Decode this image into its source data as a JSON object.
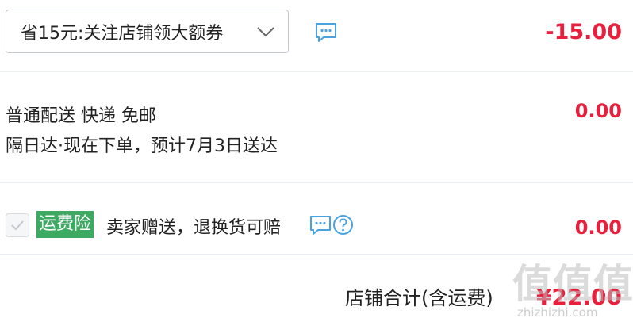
{
  "coupon": {
    "selected": "省15元:关注店铺领大额券",
    "amount": "-15.00",
    "icons": [
      "chevron-down-icon",
      "message-icon"
    ]
  },
  "shipping": {
    "method": "普通配送 快递 免邮",
    "delivery_note": "隔日达·现在下单，预计7月3日送达",
    "amount": "0.00"
  },
  "insurance": {
    "badge": "运费险",
    "description": "卖家赠送，退换货可赔",
    "amount": "0.00",
    "icons": [
      "checkbox-icon",
      "message-icon",
      "question-icon"
    ]
  },
  "total": {
    "label": "店铺合计(含运费)",
    "amount": "¥22.00"
  },
  "watermark": {
    "logo_text": "值值值",
    "site": "zhizhizhi.com"
  },
  "colors": {
    "price_red": "#e8203d",
    "icon_blue": "#4aa3df",
    "badge_green": "#3daa62",
    "divider": "#e9eef4"
  }
}
